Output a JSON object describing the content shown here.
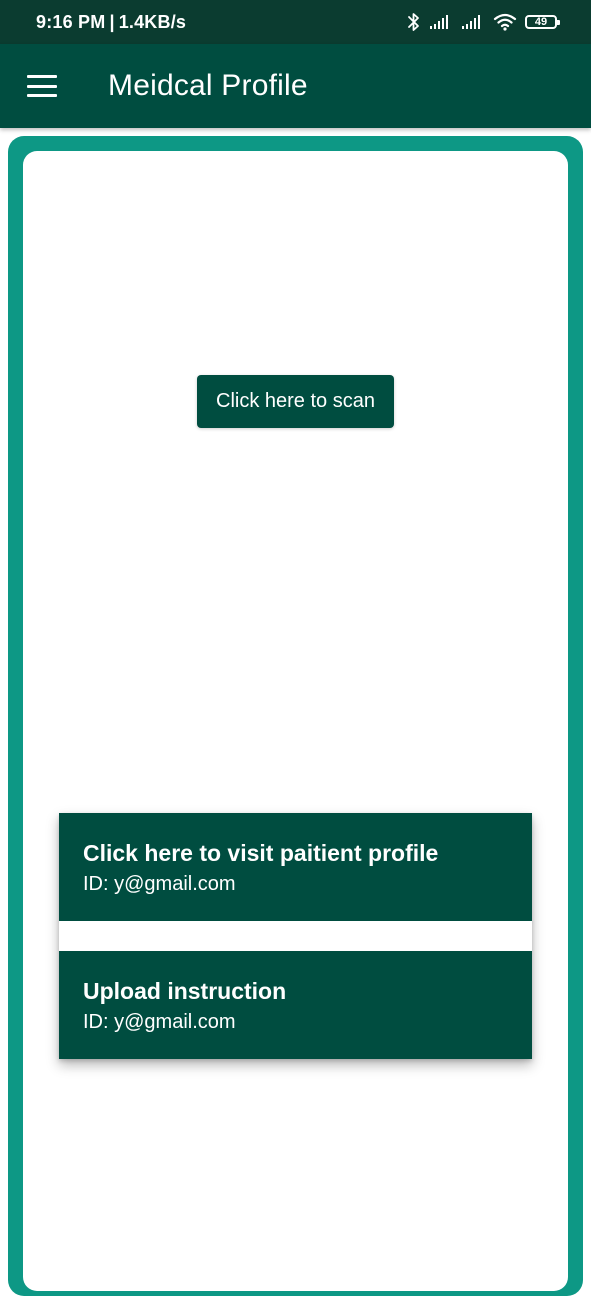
{
  "status_bar": {
    "time": "9:16 PM",
    "separator": "|",
    "speed": "1.4KB/s",
    "battery_level": "49",
    "icons": [
      "bluetooth-icon",
      "signal-icon",
      "signal-icon",
      "wifi-icon",
      "battery-icon"
    ]
  },
  "app_bar": {
    "title": "Meidcal Profile",
    "menu_icon": "hamburger-menu-icon"
  },
  "main": {
    "scan_button_label": "Click here to scan",
    "cards": [
      {
        "title": "Click here to visit paitient profile",
        "subtitle": "ID: y@gmail.com"
      },
      {
        "title": "Upload instruction",
        "subtitle": "ID: y@gmail.com"
      }
    ]
  },
  "colors": {
    "status_bar": "#0b3c30",
    "primary": "#004d40",
    "frame": "#0d9885",
    "surface": "#ffffff"
  }
}
